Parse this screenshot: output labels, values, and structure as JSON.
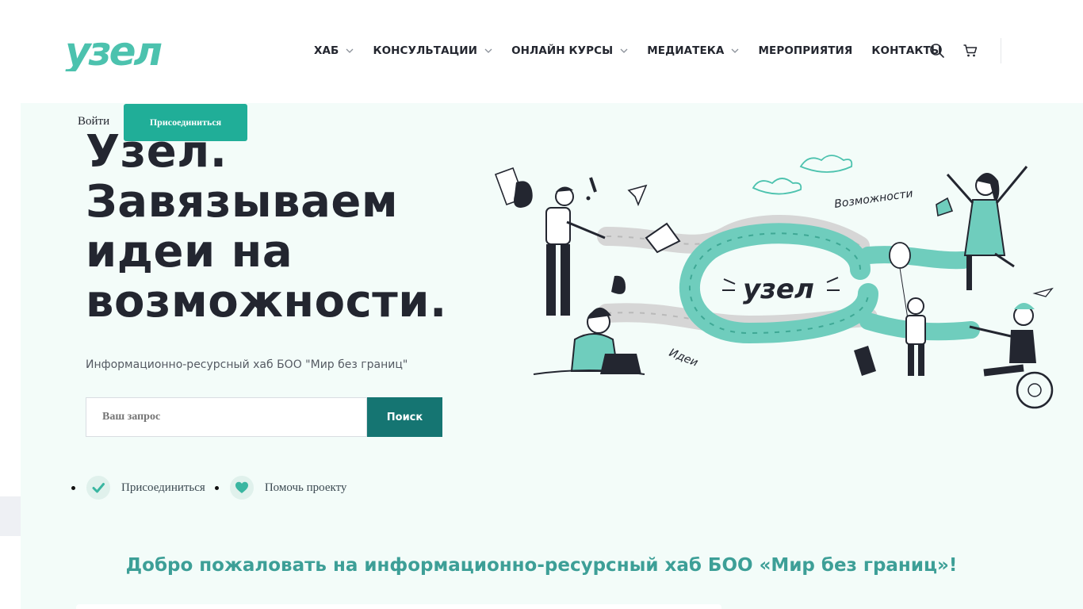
{
  "brand": {
    "logo_text": "узел",
    "logo_color": "#4cc2ae",
    "accent": "#20ae98",
    "dark": "#232630",
    "search_button_color": "#157572"
  },
  "nav": {
    "items": [
      {
        "label": "ХАБ",
        "has_dropdown": true
      },
      {
        "label": "КОНСУЛЬТАЦИИ",
        "has_dropdown": true
      },
      {
        "label": "ОНЛАЙН КУРСЫ",
        "has_dropdown": true
      },
      {
        "label": "МЕДИАТЕКА",
        "has_dropdown": true
      },
      {
        "label": "МЕРОПРИЯТИЯ",
        "has_dropdown": false
      },
      {
        "label": "КОНТАКТЫ",
        "has_dropdown": false
      }
    ],
    "icons": [
      "search-icon",
      "cart-icon"
    ]
  },
  "auth": {
    "login_label": "Войти",
    "join_label": "Присоединиться"
  },
  "hero": {
    "title": "Узел.\nЗавязываем\nидеи на\nвозможности.",
    "subtitle": "Информационно-ресурсный хаб БОО \"Мир без границ\"",
    "search": {
      "placeholder": "Ваш запрос",
      "button_label": "Поиск"
    },
    "actions": [
      {
        "label": "Присоединиться",
        "icon": "check-icon"
      },
      {
        "label": "Помочь проекту",
        "icon": "heart-icon"
      }
    ],
    "illustration": {
      "knot_label": "узел",
      "word_ideas": "Идеи",
      "word_opportunities": "Возможности"
    }
  },
  "welcome_heading": "Добро пожаловать на информационно-ресурсный хаб БОО «Мир без границ»!"
}
